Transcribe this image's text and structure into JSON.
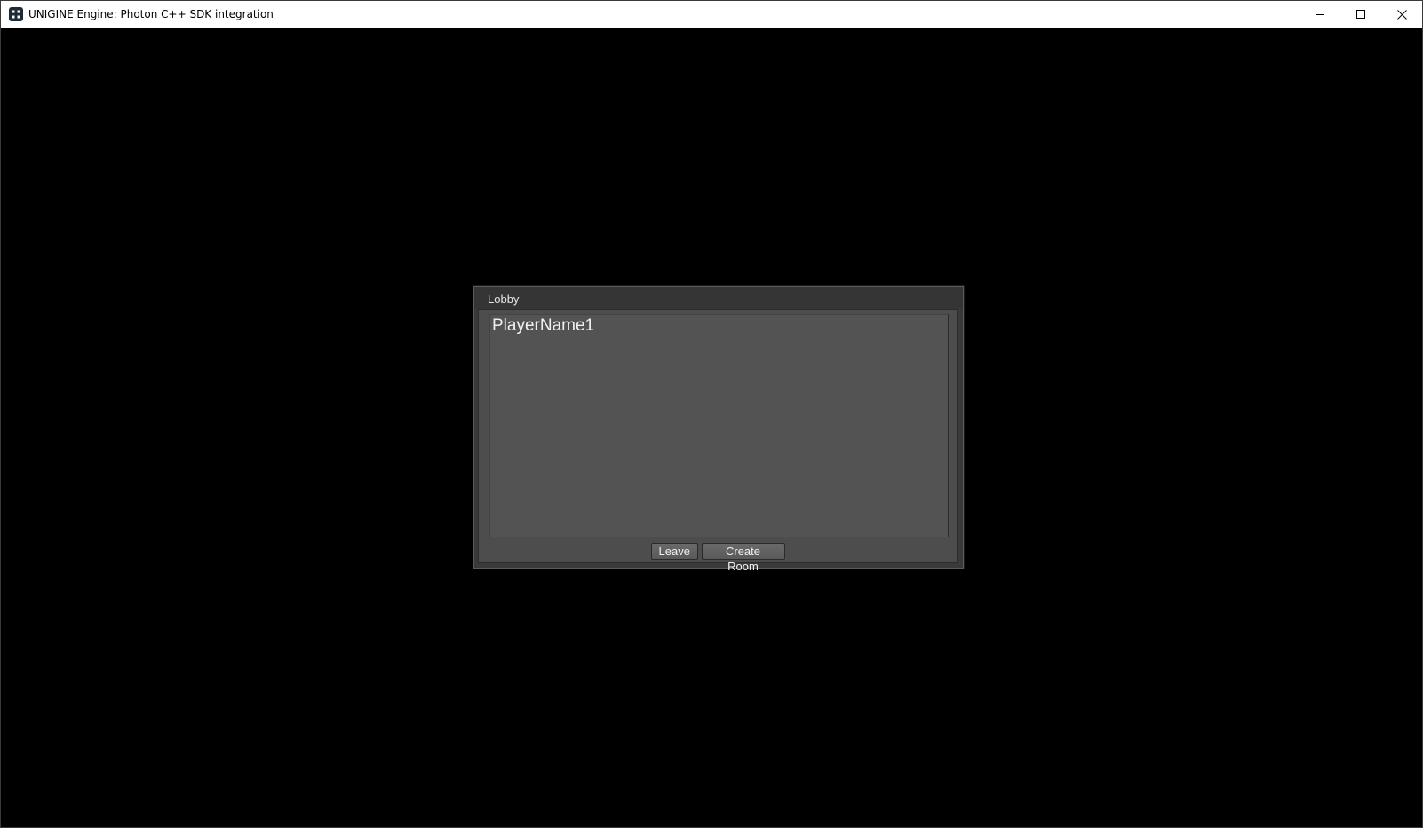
{
  "window": {
    "title": "UNIGINE Engine: Photon C++ SDK integration",
    "icon": "unigine-app-icon",
    "controls": [
      "minimize-icon",
      "maximize-icon",
      "close-icon"
    ]
  },
  "lobby": {
    "title": "Lobby",
    "players": [
      "PlayerName1"
    ],
    "buttons": {
      "leave": "Leave",
      "create_room": "Create Room"
    }
  },
  "colors": {
    "viewport_bg": "#000000",
    "dialog_bg": "#3a3a3a",
    "list_bg": "#535353",
    "text": "#f0f0f0"
  }
}
